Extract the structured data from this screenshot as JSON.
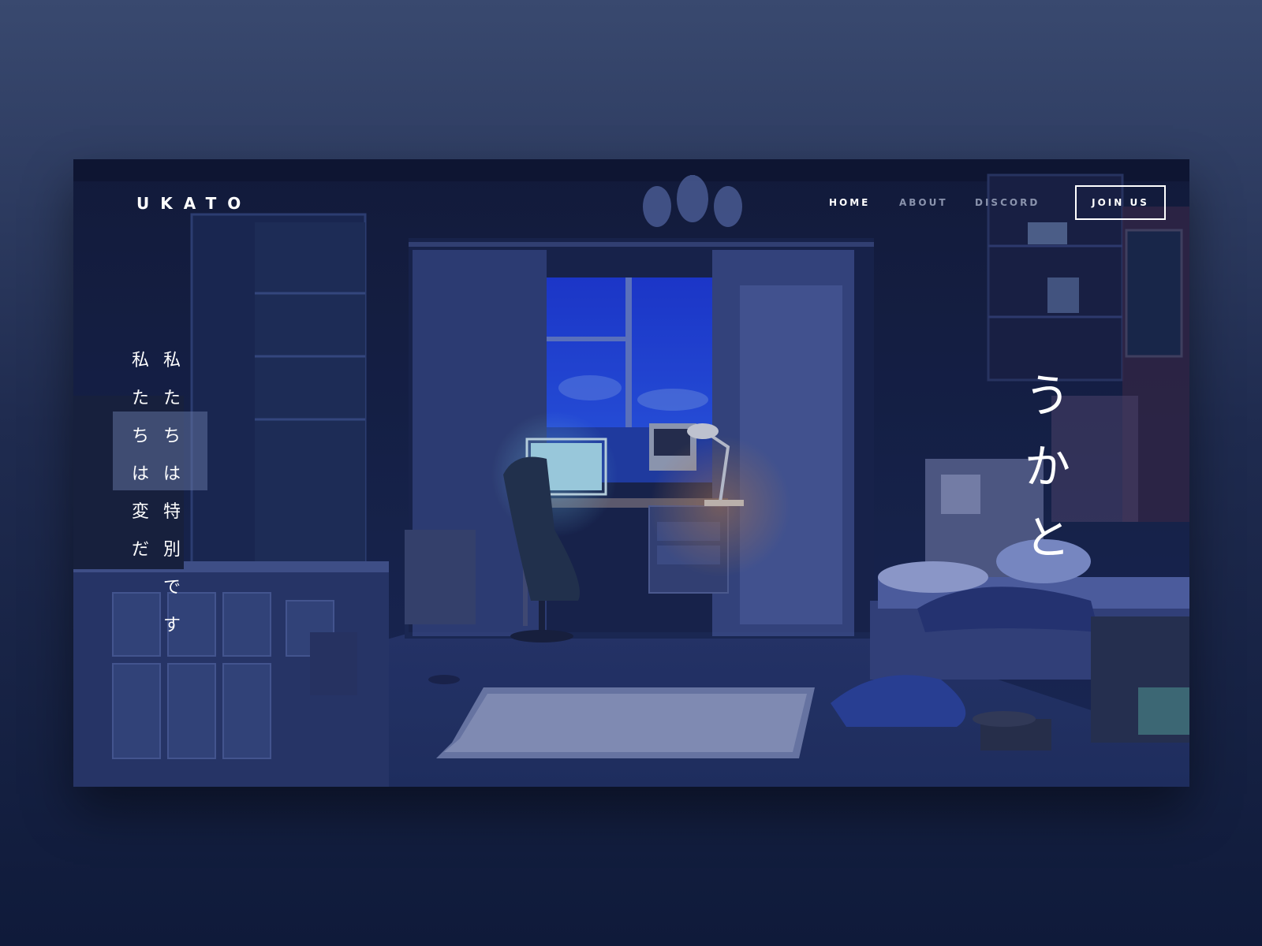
{
  "brand": {
    "logo": "UKATO"
  },
  "nav": {
    "items": [
      {
        "label": "HOME",
        "active": true
      },
      {
        "label": "ABOUT",
        "active": false
      },
      {
        "label": "DISCORD",
        "active": false
      }
    ],
    "cta_label": "JOIN US"
  },
  "hero": {
    "tagline_col1": [
      "私",
      "た",
      "ち",
      "は",
      "変",
      "だ"
    ],
    "tagline_col2": [
      "私",
      "た",
      "ち",
      "は",
      "特",
      "別",
      "で",
      "す"
    ],
    "title_vertical": [
      "う",
      "か",
      "と"
    ]
  },
  "colors": {
    "page_bg_top": "#39496f",
    "page_bg_bottom": "#0f1a3a",
    "scene_night_blue": "#1b2f6b",
    "window_blue": "#1a4fff",
    "nav_inactive": "#8a93ad"
  }
}
